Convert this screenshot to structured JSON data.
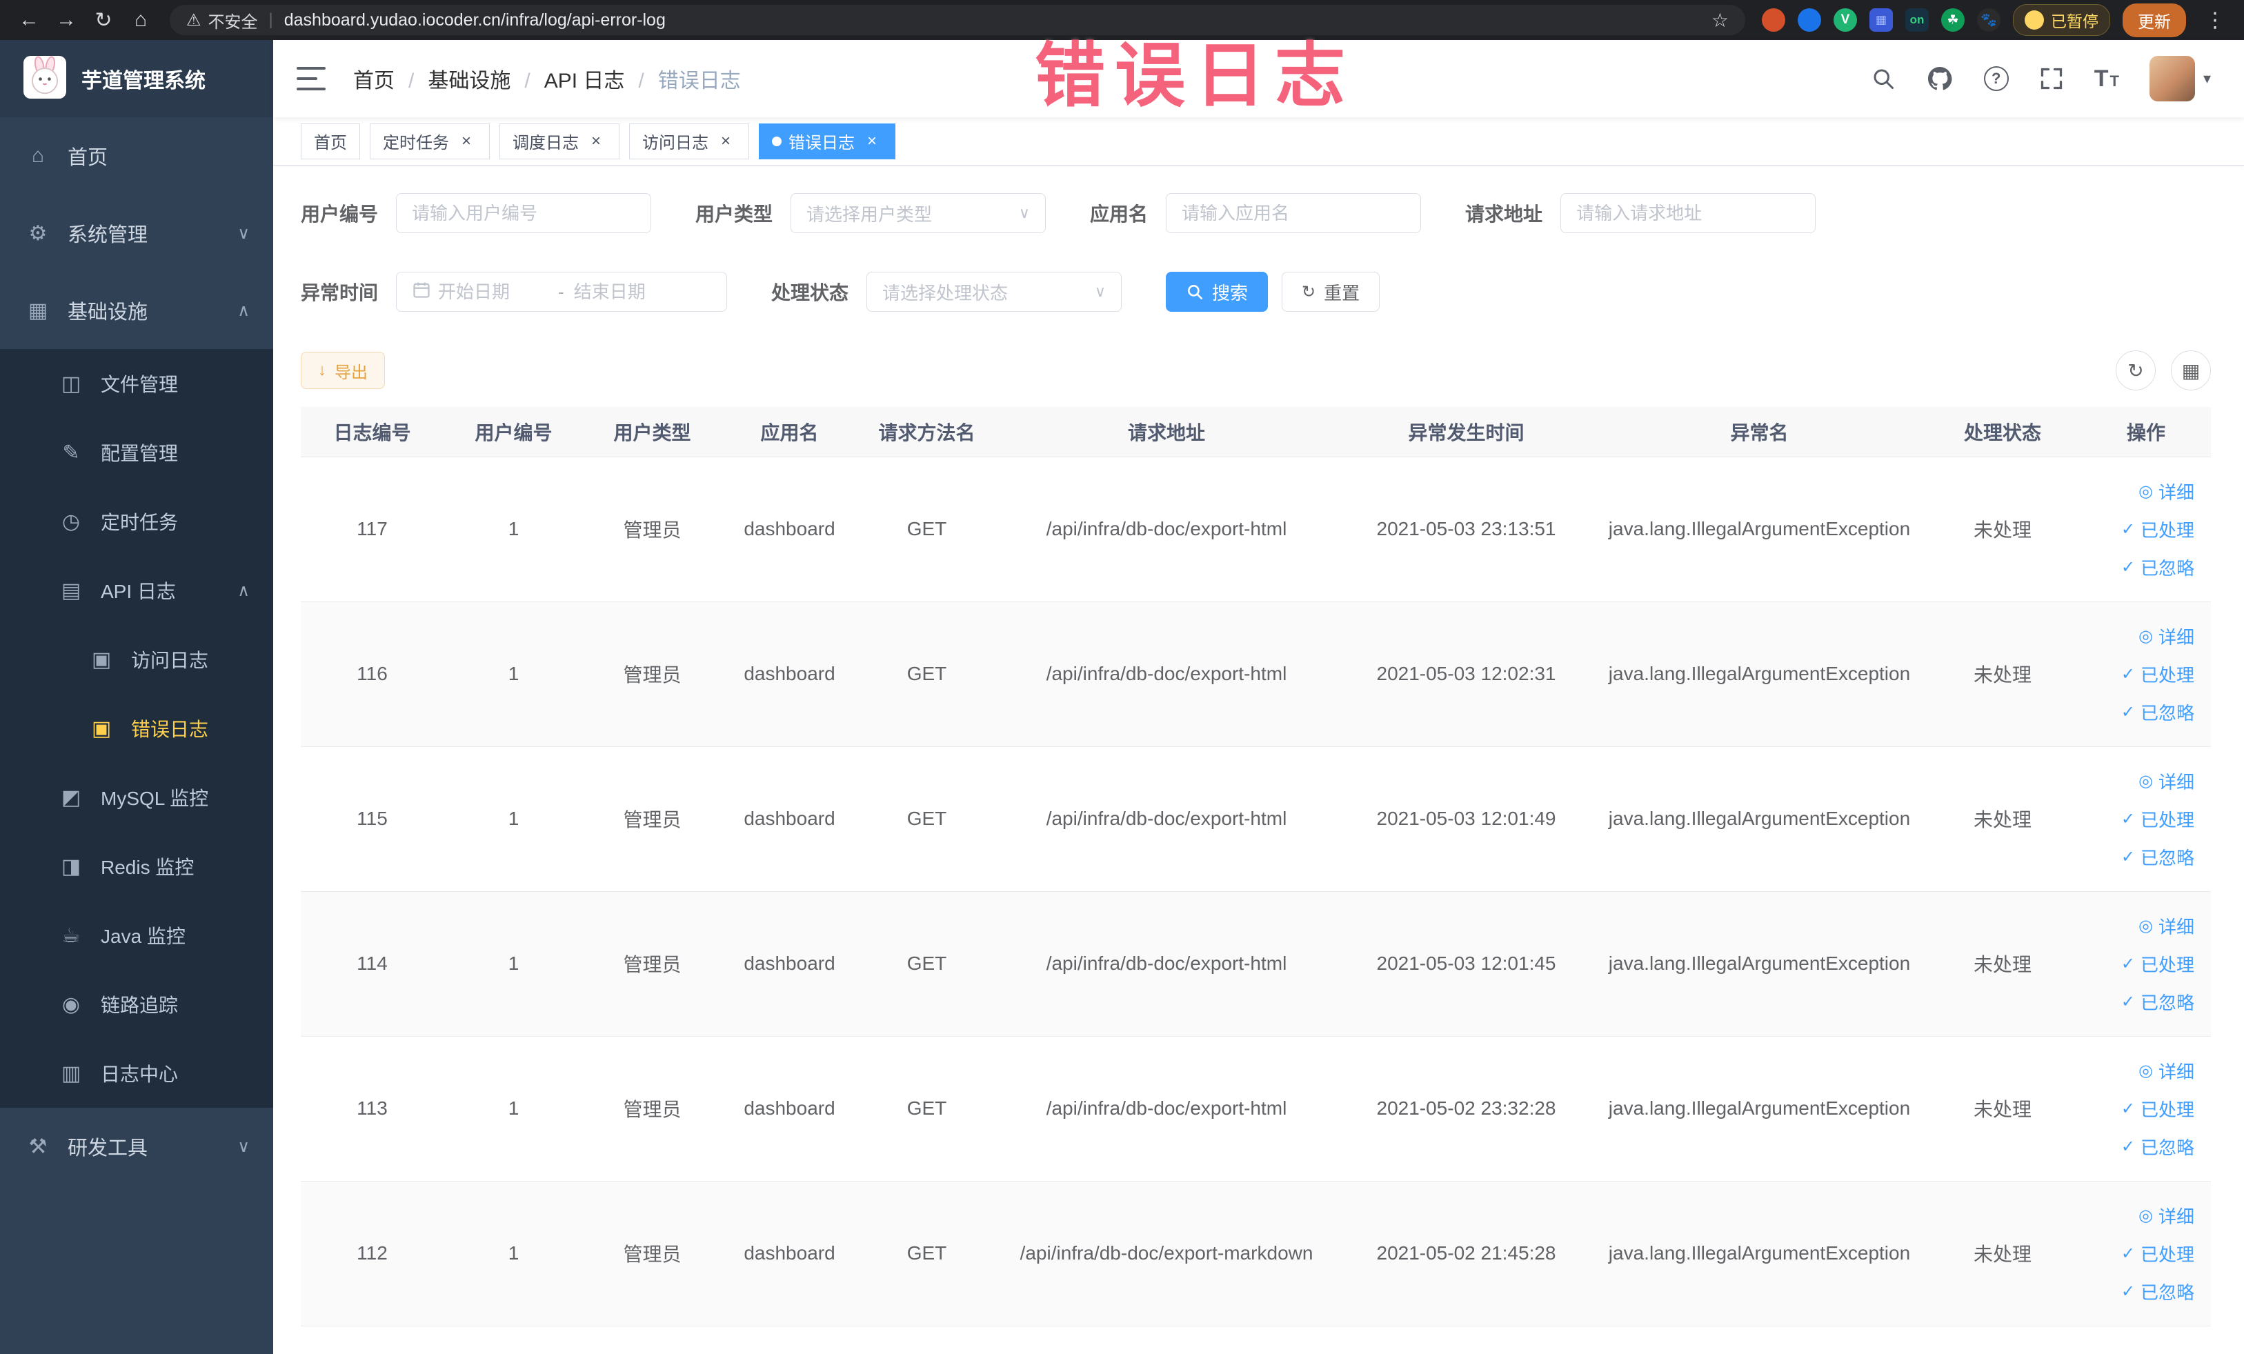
{
  "colors": {
    "primary": "#409eff",
    "warning": "#e6a23c",
    "sidebar_bg": "#304156",
    "sidebar_submenu_bg": "#1f2d3d",
    "sidebar_active_text": "#ffd04b",
    "annotation": "#f33f5f"
  },
  "browser": {
    "security_label": "不安全",
    "url": "dashboard.yudao.iocoder.cn/infra/log/api-error-log",
    "ext_on_badge": "on",
    "paused_badge": "已暂停",
    "update_button": "更新"
  },
  "annotation": {
    "text": "错误日志"
  },
  "sidebar": {
    "title": "芋道管理系统",
    "items": {
      "home": "首页",
      "system": "系统管理",
      "infra": "基础设施",
      "file": "文件管理",
      "config": "配置管理",
      "job": "定时任务",
      "api_log": "API 日志",
      "access_log": "访问日志",
      "error_log": "错误日志",
      "mysql": "MySQL 监控",
      "redis": "Redis 监控",
      "java": "Java 监控",
      "trace": "链路追踪",
      "log_center": "日志中心",
      "dev_tools": "研发工具"
    }
  },
  "header": {
    "breadcrumb": [
      "首页",
      "基础设施",
      "API 日志",
      "错误日志"
    ]
  },
  "tabs": [
    {
      "label": "首页",
      "closable": false,
      "active": false
    },
    {
      "label": "定时任务",
      "closable": true,
      "active": false
    },
    {
      "label": "调度日志",
      "closable": true,
      "active": false
    },
    {
      "label": "访问日志",
      "closable": true,
      "active": false
    },
    {
      "label": "错误日志",
      "closable": true,
      "active": true
    }
  ],
  "filters": {
    "user_id_label": "用户编号",
    "user_id_placeholder": "请输入用户编号",
    "user_type_label": "用户类型",
    "user_type_placeholder": "请选择用户类型",
    "app_name_label": "应用名",
    "app_name_placeholder": "请输入应用名",
    "request_url_label": "请求地址",
    "request_url_placeholder": "请输入请求地址",
    "exception_time_label": "异常时间",
    "date_start_placeholder": "开始日期",
    "date_separator": "-",
    "date_end_placeholder": "结束日期",
    "process_status_label": "处理状态",
    "process_status_placeholder": "请选择处理状态",
    "search_button": "搜索",
    "reset_button": "重置"
  },
  "toolbar": {
    "export_button": "导出"
  },
  "table": {
    "headers": [
      "日志编号",
      "用户编号",
      "用户类型",
      "应用名",
      "请求方法名",
      "请求地址",
      "异常发生时间",
      "异常名",
      "处理状态",
      "操作"
    ],
    "actions": {
      "detail": "详细",
      "processed": "已处理",
      "ignored": "已忽略"
    },
    "rows": [
      {
        "id": "117",
        "user_id": "1",
        "user_type": "管理员",
        "app": "dashboard",
        "method": "GET",
        "url": "/api/infra/db-doc/export-html",
        "time": "2021-05-03 23:13:51",
        "exception": "java.lang.IllegalArgumentException",
        "status": "未处理"
      },
      {
        "id": "116",
        "user_id": "1",
        "user_type": "管理员",
        "app": "dashboard",
        "method": "GET",
        "url": "/api/infra/db-doc/export-html",
        "time": "2021-05-03 12:02:31",
        "exception": "java.lang.IllegalArgumentException",
        "status": "未处理"
      },
      {
        "id": "115",
        "user_id": "1",
        "user_type": "管理员",
        "app": "dashboard",
        "method": "GET",
        "url": "/api/infra/db-doc/export-html",
        "time": "2021-05-03 12:01:49",
        "exception": "java.lang.IllegalArgumentException",
        "status": "未处理"
      },
      {
        "id": "114",
        "user_id": "1",
        "user_type": "管理员",
        "app": "dashboard",
        "method": "GET",
        "url": "/api/infra/db-doc/export-html",
        "time": "2021-05-03 12:01:45",
        "exception": "java.lang.IllegalArgumentException",
        "status": "未处理"
      },
      {
        "id": "113",
        "user_id": "1",
        "user_type": "管理员",
        "app": "dashboard",
        "method": "GET",
        "url": "/api/infra/db-doc/export-html",
        "time": "2021-05-02 23:32:28",
        "exception": "java.lang.IllegalArgumentException",
        "status": "未处理"
      },
      {
        "id": "112",
        "user_id": "1",
        "user_type": "管理员",
        "app": "dashboard",
        "method": "GET",
        "url": "/api/infra/db-doc/export-markdown",
        "time": "2021-05-02 21:45:28",
        "exception": "java.lang.IllegalArgumentException",
        "status": "未处理"
      }
    ]
  }
}
